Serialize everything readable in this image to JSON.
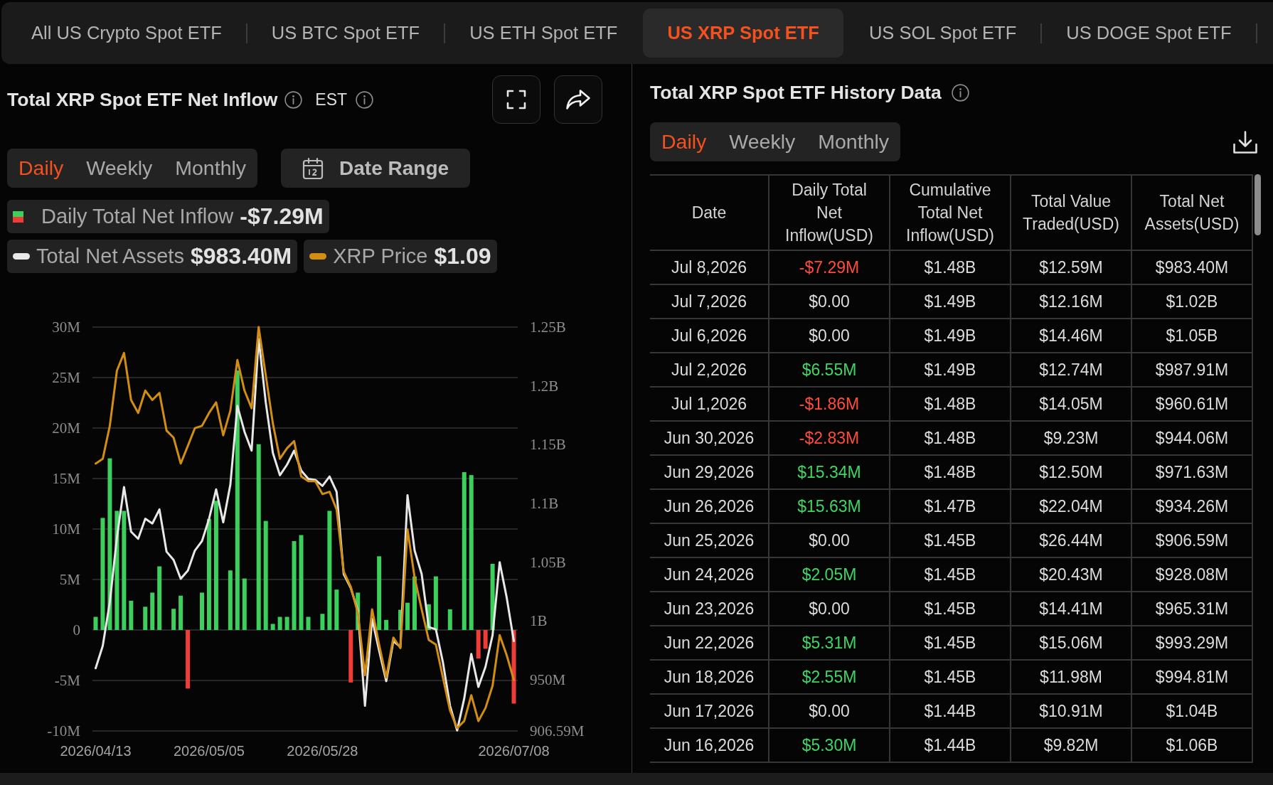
{
  "tabs": [
    {
      "label": "All US Crypto Spot ETF",
      "selected": false
    },
    {
      "label": "US BTC Spot ETF",
      "selected": false
    },
    {
      "label": "US ETH Spot ETF",
      "selected": false
    },
    {
      "label": "US XRP Spot ETF",
      "selected": true
    },
    {
      "label": "US SOL Spot ETF",
      "selected": false
    },
    {
      "label": "US DOGE Spot ETF",
      "selected": false
    }
  ],
  "inflow_panel": {
    "title": "Total XRP Spot ETF Net Inflow",
    "timezone": "EST",
    "periods": [
      {
        "label": "Daily",
        "selected": true
      },
      {
        "label": "Weekly",
        "selected": false
      },
      {
        "label": "Monthly",
        "selected": false
      }
    ],
    "date_range_button": "Date Range",
    "legend_rows": [
      {
        "items": [
          {
            "kind": "bar",
            "label": "Daily Total Net Inflow",
            "value": "-$7.29M"
          }
        ]
      },
      {
        "items": [
          {
            "kind": "line",
            "label": "Total Net Assets",
            "value": "$983.40M"
          },
          {
            "kind": "line",
            "label": "XRP Price",
            "value": "$1.09"
          }
        ]
      }
    ],
    "chart_data": {
      "type": "bar",
      "grid": true,
      "categories": [
        "2026/04/13",
        null,
        null,
        null,
        null,
        null,
        null,
        null,
        null,
        null,
        null,
        null,
        null,
        null,
        null,
        null,
        "2026/05/05",
        null,
        null,
        null,
        null,
        null,
        null,
        null,
        null,
        null,
        null,
        null,
        null,
        null,
        null,
        null,
        "2026/05/28",
        null,
        null,
        null,
        null,
        null,
        null,
        null,
        null,
        null,
        null,
        null,
        null,
        null,
        null,
        null,
        null,
        null,
        null,
        null,
        null,
        null,
        null,
        null,
        null,
        null,
        null,
        "2026/07/08"
      ],
      "ylim": [
        -10,
        30
      ],
      "yticks": [
        {
          "value": 30,
          "label": "30M"
        },
        {
          "value": 25,
          "label": "25M"
        },
        {
          "value": 20,
          "label": "20M"
        },
        {
          "value": 15,
          "label": "15M"
        },
        {
          "value": 10,
          "label": "10M"
        },
        {
          "value": 5,
          "label": "5M"
        },
        {
          "value": 0,
          "label": "0"
        },
        {
          "value": -5,
          "label": "-5M"
        },
        {
          "value": -10,
          "label": "-10M"
        }
      ],
      "y2lim": [
        906590000,
        1250000000
      ],
      "y2ticks": [
        {
          "value": 1250000000,
          "label": "1.25B"
        },
        {
          "value": 1200000000,
          "label": "1.2B"
        },
        {
          "value": 1150000000,
          "label": "1.15B"
        },
        {
          "value": 1100000000,
          "label": "1.1B"
        },
        {
          "value": 1050000000,
          "label": "1.05B"
        },
        {
          "value": 1000000000,
          "label": "1B"
        },
        {
          "value": 950000000,
          "label": "950M"
        },
        {
          "value": 906590000,
          "label": "906.59M"
        }
      ],
      "series": [
        {
          "type": "bar",
          "color": "#3ccf5b",
          "values": [
            1.3,
            11.1,
            17.0,
            11.8,
            11.8,
            2.9,
            0,
            2.3,
            3.7,
            6.3,
            0,
            2.1,
            3.4,
            0,
            0,
            3.7,
            11.0,
            12.8,
            0,
            5.9,
            25.7,
            5.1,
            0,
            18.4,
            10.8,
            0.6,
            1.3,
            1.3,
            8.8,
            9.4,
            1.3,
            0,
            1.6,
            11.8,
            4.0,
            0,
            0,
            3.7,
            0,
            0,
            7.3,
            1.0,
            0,
            2.0,
            2.7,
            5.3,
            0,
            2.55,
            5.31,
            0,
            2.05,
            0,
            15.63,
            15.34,
            0,
            0,
            6.55,
            0,
            0,
            0
          ]
        },
        {
          "type": "bar",
          "color": "#f03c37",
          "values": [
            0,
            0,
            0,
            0,
            0,
            0,
            0,
            0,
            0,
            0,
            0,
            0,
            0,
            -5.8,
            0,
            0,
            0,
            0,
            0,
            0,
            0,
            0,
            0,
            0,
            0,
            0,
            0,
            0,
            0,
            0,
            0,
            0,
            0,
            0,
            0,
            0,
            -5.2,
            0,
            0,
            0,
            0,
            0,
            0,
            0,
            0,
            0,
            0,
            0,
            0,
            0,
            0,
            0,
            0,
            0,
            -2.83,
            -1.86,
            0,
            0,
            0,
            -7.29
          ]
        },
        {
          "type": "line",
          "axis": "y2",
          "color": "#e8e8e8",
          "values": [
            960000000,
            979000000,
            1016000000,
            1071000000,
            1114000000,
            1076000000,
            1070000000,
            1087000000,
            1083000000,
            1095000000,
            1059000000,
            1052000000,
            1036000000,
            1043000000,
            1060000000,
            1068000000,
            1087000000,
            1112000000,
            1084000000,
            1116000000,
            1183000000,
            1161000000,
            1145000000,
            1240000000,
            1186000000,
            1143000000,
            1124000000,
            1133000000,
            1145000000,
            1128000000,
            1121000000,
            1120000000,
            1115000000,
            1123000000,
            1110000000,
            1040000000,
            1028000000,
            1009000000,
            928000000,
            1002000000,
            975000000,
            949000000,
            983000000,
            978000000,
            1107000000,
            1060000000,
            1040000000,
            995000000,
            993000000,
            965000000,
            928000000,
            907000000,
            934000000,
            972000000,
            944000000,
            961000000,
            988000000,
            1050000000,
            1020000000,
            983000000
          ]
        },
        {
          "type": "line",
          "axis": "y2",
          "color": "#d28e12",
          "values": [
            1134000000,
            1138000000,
            1166000000,
            1213000000,
            1228000000,
            1188000000,
            1177000000,
            1196000000,
            1188000000,
            1194000000,
            1162000000,
            1156000000,
            1134000000,
            1149000000,
            1164000000,
            1166000000,
            1177000000,
            1186000000,
            1158000000,
            1179000000,
            1222000000,
            1196000000,
            1181000000,
            1250000000,
            1209000000,
            1168000000,
            1138000000,
            1147000000,
            1153000000,
            1123000000,
            1119000000,
            1119000000,
            1108000000,
            1110000000,
            1095000000,
            1042000000,
            1029000000,
            1007000000,
            954000000,
            1010000000,
            980000000,
            952000000,
            986000000,
            977000000,
            1078000000,
            1037000000,
            1010000000,
            984000000,
            980000000,
            952000000,
            924000000,
            909000000,
            915000000,
            937000000,
            915000000,
            926000000,
            945000000,
            988000000,
            971000000,
            950000000
          ]
        }
      ]
    }
  },
  "history_panel": {
    "title": "Total XRP Spot ETF History Data",
    "periods": [
      {
        "label": "Daily",
        "selected": true
      },
      {
        "label": "Weekly",
        "selected": false
      },
      {
        "label": "Monthly",
        "selected": false
      }
    ],
    "table": {
      "columns": [
        "Date",
        "Daily Total Net Inflow(USD)",
        "Cumulative Total Net Inflow(USD)",
        "Total Value Traded(USD)",
        "Total Net Assets(USD)"
      ],
      "rows": [
        {
          "kind": "outflow",
          "cells": [
            "Jul 8,2026",
            "-$7.29M",
            "$1.48B",
            "$12.59M",
            "$983.40M"
          ]
        },
        {
          "kind": "neutral",
          "cells": [
            "Jul 7,2026",
            "$0.00",
            "$1.49B",
            "$12.16M",
            "$1.02B"
          ]
        },
        {
          "kind": "neutral",
          "cells": [
            "Jul 6,2026",
            "$0.00",
            "$1.49B",
            "$14.46M",
            "$1.05B"
          ]
        },
        {
          "kind": "inflow",
          "cells": [
            "Jul 2,2026",
            "$6.55M",
            "$1.49B",
            "$12.74M",
            "$987.91M"
          ]
        },
        {
          "kind": "outflow",
          "cells": [
            "Jul 1,2026",
            "-$1.86M",
            "$1.48B",
            "$14.05M",
            "$960.61M"
          ]
        },
        {
          "kind": "outflow",
          "cells": [
            "Jun 30,2026",
            "-$2.83M",
            "$1.48B",
            "$9.23M",
            "$944.06M"
          ]
        },
        {
          "kind": "inflow",
          "cells": [
            "Jun 29,2026",
            "$15.34M",
            "$1.48B",
            "$12.50M",
            "$971.63M"
          ]
        },
        {
          "kind": "inflow",
          "cells": [
            "Jun 26,2026",
            "$15.63M",
            "$1.47B",
            "$22.04M",
            "$934.26M"
          ]
        },
        {
          "kind": "neutral",
          "cells": [
            "Jun 25,2026",
            "$0.00",
            "$1.45B",
            "$26.44M",
            "$906.59M"
          ]
        },
        {
          "kind": "inflow",
          "cells": [
            "Jun 24,2026",
            "$2.05M",
            "$1.45B",
            "$20.43M",
            "$928.08M"
          ]
        },
        {
          "kind": "neutral",
          "cells": [
            "Jun 23,2026",
            "$0.00",
            "$1.45B",
            "$14.41M",
            "$965.31M"
          ]
        },
        {
          "kind": "inflow",
          "cells": [
            "Jun 22,2026",
            "$5.31M",
            "$1.45B",
            "$15.06M",
            "$993.29M"
          ]
        },
        {
          "kind": "inflow",
          "cells": [
            "Jun 18,2026",
            "$2.55M",
            "$1.45B",
            "$11.98M",
            "$994.81M"
          ]
        },
        {
          "kind": "neutral",
          "cells": [
            "Jun 17,2026",
            "$0.00",
            "$1.44B",
            "$10.91M",
            "$1.04B"
          ]
        },
        {
          "kind": "inflow",
          "cells": [
            "Jun 16,2026",
            "$5.30M",
            "$1.44B",
            "$9.82M",
            "$1.06B"
          ]
        }
      ]
    }
  }
}
